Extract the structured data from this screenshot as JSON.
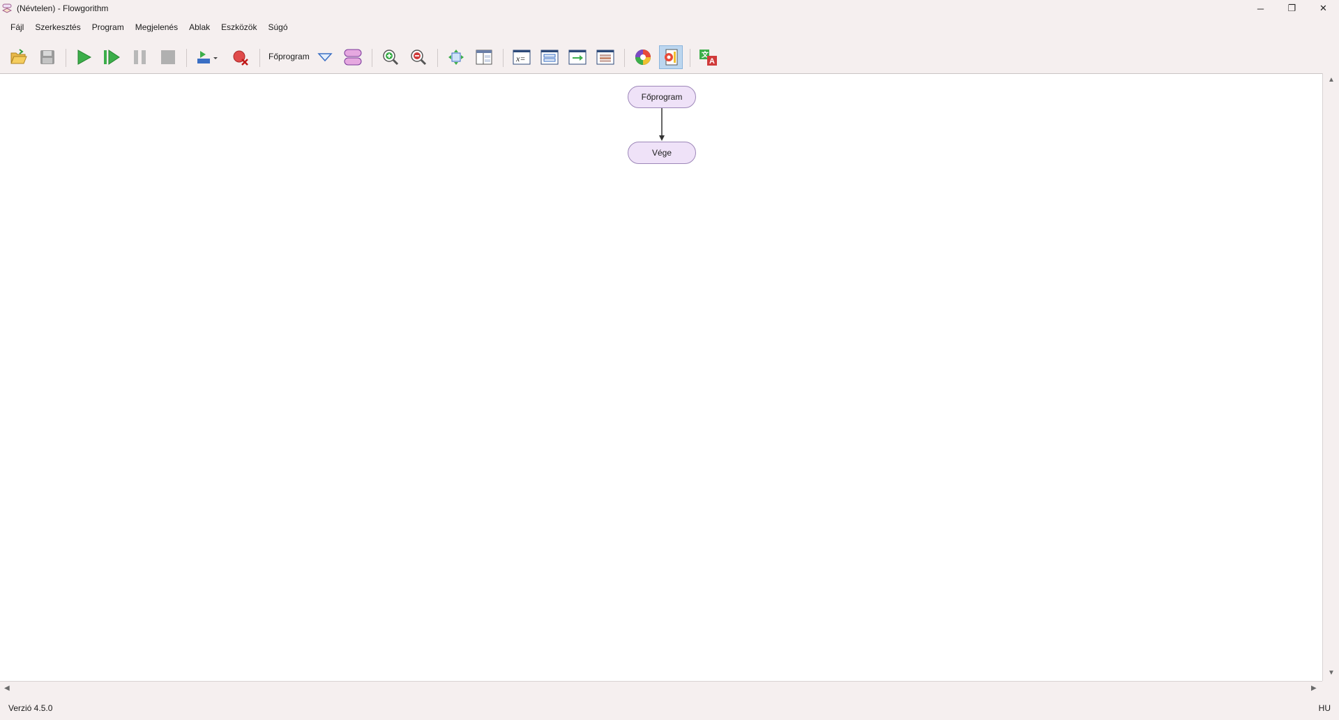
{
  "window": {
    "title": "(Névtelen) - Flowgorithm",
    "controls": {
      "minimize": "─",
      "restore": "❐",
      "close": "✕"
    }
  },
  "menu": {
    "items": [
      {
        "id": "fajl",
        "label": "Fájl"
      },
      {
        "id": "szerkesztes",
        "label": "Szerkesztés"
      },
      {
        "id": "program",
        "label": "Program"
      },
      {
        "id": "megjelenes",
        "label": "Megjelenés"
      },
      {
        "id": "ablak",
        "label": "Ablak"
      },
      {
        "id": "eszkozok",
        "label": "Eszközök"
      },
      {
        "id": "sugo",
        "label": "Súgó"
      }
    ]
  },
  "toolbar": {
    "function_selector": "Főprogram",
    "buttons": [
      "open-folder-icon",
      "save-icon",
      "run-icon",
      "step-icon",
      "pause-icon",
      "stop-icon",
      "watch-dropdown-icon",
      "clear-breakpoint-icon",
      "function-dropdown-icon",
      "add-function-icon",
      "zoom-in-icon",
      "zoom-out-icon",
      "fit-layout-icon",
      "split-layout-icon",
      "variables-window-icon",
      "source-window-icon",
      "console-window-icon",
      "chart-window-icon",
      "color-theme-icon",
      "layout-style-icon",
      "translate-icon"
    ]
  },
  "flowchart": {
    "start_label": "Főprogram",
    "end_label": "Vége"
  },
  "status": {
    "version": "Verzió 4.5.0",
    "language": "HU"
  },
  "colors": {
    "node_fill": "#efe2f8",
    "node_border": "#9c86b8",
    "run_green": "#3cae4a",
    "window_bg": "#f5efef"
  }
}
